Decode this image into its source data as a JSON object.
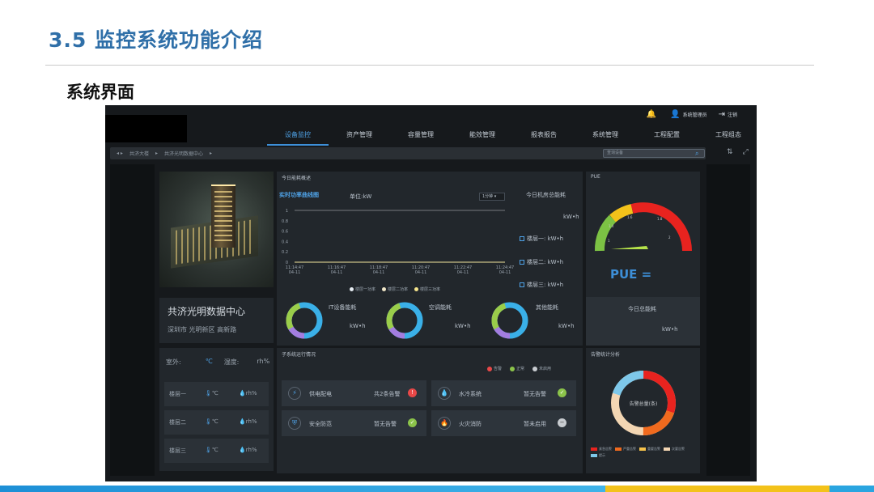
{
  "slide": {
    "title": "3.5 监控系统功能介绍",
    "subtitle": "系统界面"
  },
  "app": {
    "top_bar": {
      "alarm_icon": "bell-icon",
      "user_label": "系统管理员",
      "logout_label": "注销"
    },
    "nav": [
      {
        "label": "设备监控",
        "active": true
      },
      {
        "label": "资产管理",
        "active": false
      },
      {
        "label": "容量管理",
        "active": false
      },
      {
        "label": "能效管理",
        "active": false
      },
      {
        "label": "报表报告",
        "active": false
      },
      {
        "label": "系统管理",
        "active": false
      },
      {
        "label": "工程配置",
        "active": false
      },
      {
        "label": "工程组态",
        "active": false
      }
    ],
    "breadcrumb": [
      "共济大楼",
      "共济光明数据中心"
    ],
    "search_placeholder": "查询设备",
    "datacenter": {
      "name": "共济光明数据中心",
      "address": "深圳市 光明新区 高新路"
    },
    "environment": {
      "outdoor_label": "室外:",
      "outdoor_temp_unit": "℃",
      "humidity_label": "湿度:",
      "humidity_unit": "rh%",
      "floors": [
        {
          "label": "楼层一",
          "temp": "℃",
          "hum": "rh%"
        },
        {
          "label": "楼层二",
          "temp": "℃",
          "hum": "rh%"
        },
        {
          "label": "楼层三",
          "temp": "℃",
          "hum": "rh%"
        }
      ]
    },
    "energy": {
      "card_title": "今日能耗概述",
      "curve_title": "实时功率曲线图",
      "unit": "单位:kW",
      "interval": "1分钟",
      "day_title": "今日机房总能耗",
      "day_unit": "kW•h",
      "floors": [
        {
          "label": "楼层一: kW•h"
        },
        {
          "label": "楼层二: kW•h"
        },
        {
          "label": "楼层三: kW•h"
        }
      ],
      "legend": [
        "楼层一功率",
        "楼层二功率",
        "楼层三功率"
      ],
      "rings": [
        {
          "label": "IT设备能耗",
          "unit": "kW•h"
        },
        {
          "label": "空调能耗",
          "unit": "kW•h"
        },
        {
          "label": "其他能耗",
          "unit": "kW•h"
        }
      ]
    },
    "pue": {
      "card_title": "PUE",
      "text": "PUE =",
      "ticks": [
        "1",
        "1.4",
        "1.6",
        "1.8",
        "2"
      ],
      "day_title": "今日总能耗",
      "day_unit": "kW•h"
    },
    "run_status": {
      "card_title": "子系统运行情况",
      "legend": [
        {
          "label": "告警",
          "color": "#e84848"
        },
        {
          "label": "正常",
          "color": "#8bc34a"
        },
        {
          "label": "未启用",
          "color": "#c8ccd0"
        }
      ],
      "systems": [
        {
          "name": "供电配电",
          "status": "共2条告警",
          "badge": "!",
          "color": "#e84848",
          "icon": "lightning-icon"
        },
        {
          "name": "水冷系统",
          "status": "暂无告警",
          "badge": "✓",
          "color": "#8bc34a",
          "icon": "water-drop-icon"
        },
        {
          "name": "安全防范",
          "status": "暂无告警",
          "badge": "✓",
          "color": "#8bc34a",
          "icon": "shield-icon"
        },
        {
          "name": "火灾消防",
          "status": "暂未启用",
          "badge": "−",
          "color": "#c8ccd0",
          "icon": "fire-icon"
        }
      ]
    },
    "alarm_stats": {
      "card_title": "告警统计分析",
      "center_label": "告警总量(条)",
      "legend": [
        {
          "label": "紧急告警",
          "color": "#e8231f"
        },
        {
          "label": "严重告警",
          "color": "#f06a1e"
        },
        {
          "label": "重要告警",
          "color": "#f6c24b"
        },
        {
          "label": "次要告警",
          "color": "#f3d6b3"
        },
        {
          "label": "提示",
          "color": "#7ec8ea"
        }
      ]
    }
  },
  "chart_data": {
    "type": "line",
    "title": "实时功率曲线图",
    "ylabel": "单位:kW",
    "ylim": [
      0,
      1
    ],
    "y_ticks": [
      "1",
      "0.8",
      "0.6",
      "0.4",
      "0.2",
      "0"
    ],
    "x": [
      "11:14:47\n04-11",
      "11:16:47\n04-11",
      "11:18:47\n04-11",
      "11:20:47\n04-11",
      "11:22:47\n04-11",
      "11:24:47\n04-11"
    ],
    "series": [
      {
        "name": "楼层一功率",
        "values": [
          0,
          0,
          0,
          0,
          0,
          0
        ]
      },
      {
        "name": "楼层二功率",
        "values": [
          0,
          0,
          0,
          0,
          0,
          0
        ]
      },
      {
        "name": "楼层三功率",
        "values": [
          0,
          0,
          0,
          0,
          0,
          0
        ]
      }
    ],
    "legend": "bottom"
  }
}
